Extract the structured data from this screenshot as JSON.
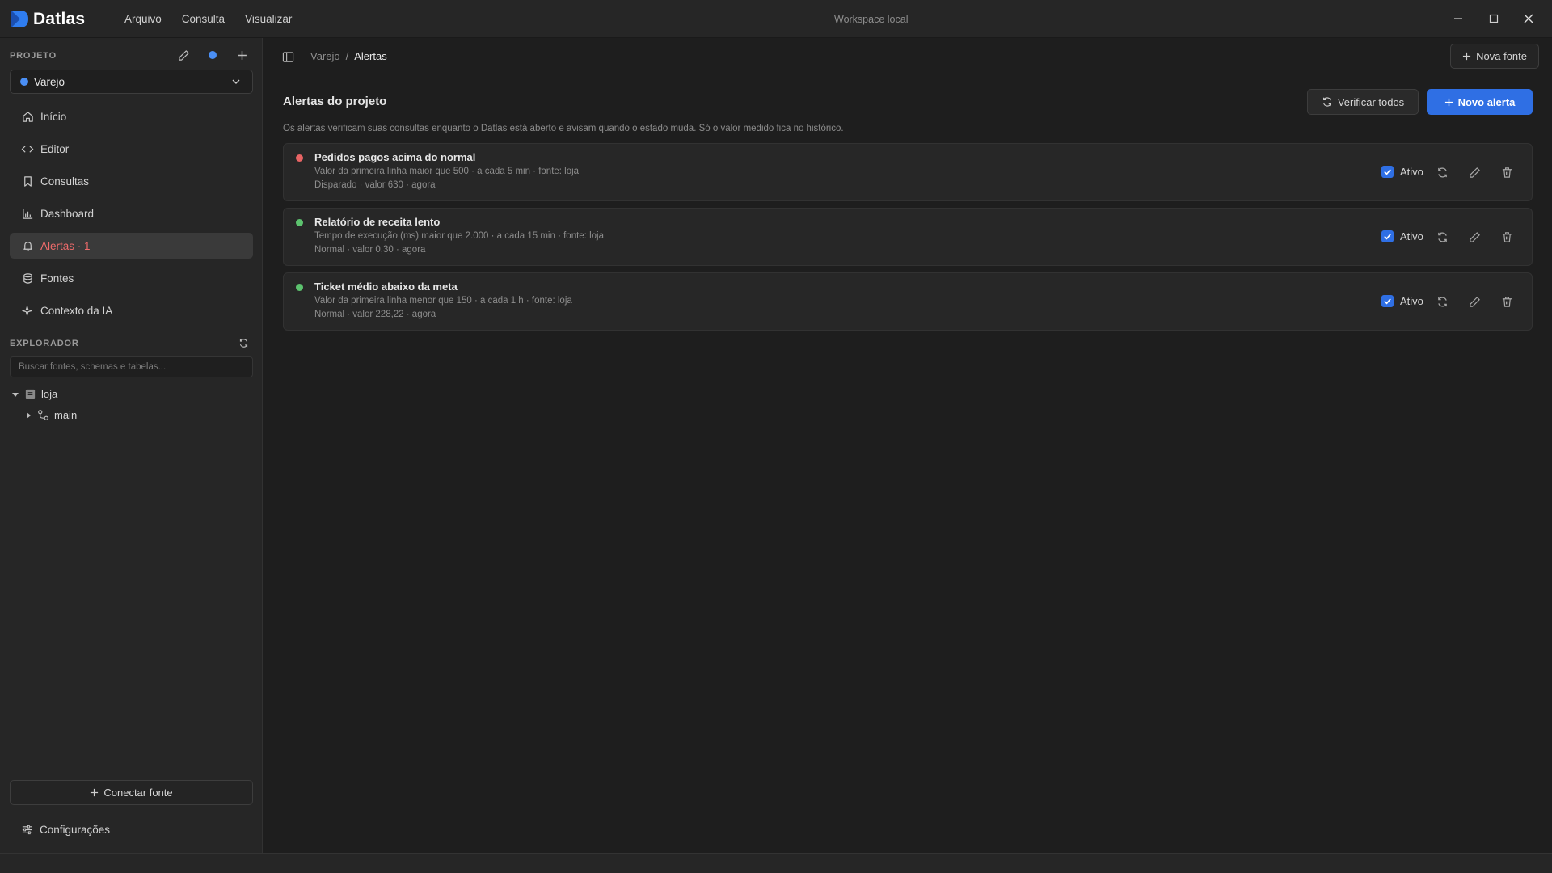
{
  "app": {
    "name": "Datlas",
    "workspace_title": "Workspace local"
  },
  "menu": [
    "Arquivo",
    "Consulta",
    "Visualizar"
  ],
  "sidebar": {
    "project_label": "PROJETO",
    "project_name": "Varejo",
    "nav": [
      {
        "label": "Início",
        "icon": "home-icon"
      },
      {
        "label": "Editor",
        "icon": "code-icon"
      },
      {
        "label": "Consultas",
        "icon": "bookmark-icon"
      },
      {
        "label": "Dashboard",
        "icon": "chart-icon"
      },
      {
        "label": "Alertas · 1",
        "icon": "bell-icon"
      },
      {
        "label": "Fontes",
        "icon": "database-icon"
      },
      {
        "label": "Contexto da IA",
        "icon": "sparkle-icon"
      }
    ],
    "explorer_label": "EXPLORADOR",
    "search_placeholder": "Buscar fontes, schemas e tabelas...",
    "tree": {
      "root": "loja",
      "child": "main"
    },
    "connect_label": "Conectar fonte",
    "settings_label": "Configurações"
  },
  "main": {
    "breadcrumb": [
      "Varejo",
      "/",
      "Alertas"
    ],
    "new_source_label": "Nova fonte",
    "title": "Alertas do projeto",
    "verify_all_label": "Verificar todos",
    "new_alert_label": "Novo alerta",
    "description": "Os alertas verificam suas consultas enquanto o Datlas está aberto e avisam quando o estado muda. Só o valor medido fica no histórico.",
    "alerts": [
      {
        "title": "Pedidos pagos acima do normal",
        "condition": "Valor da primeira linha maior que 500 · a cada 5 min · fonte: loja",
        "status": "Disparado · valor 630 · agora",
        "state_color": "#e86464",
        "active_label": "Ativo"
      },
      {
        "title": "Relatório de receita lento",
        "condition": "Tempo de execução (ms) maior que 2.000 · a cada 15 min · fonte: loja",
        "status": "Normal · valor 0,30 · agora",
        "state_color": "#5cc26e",
        "active_label": "Ativo"
      },
      {
        "title": "Ticket médio abaixo da meta",
        "condition": "Valor da primeira linha menor que 150 · a cada 1 h · fonte: loja",
        "status": "Normal · valor 228,22 · agora",
        "state_color": "#5cc26e",
        "active_label": "Ativo"
      }
    ]
  },
  "colors": {
    "accent": "#2f6fe4",
    "alert_active_nav": "#ef6b6b"
  }
}
